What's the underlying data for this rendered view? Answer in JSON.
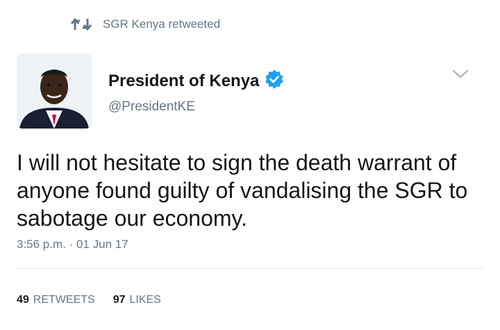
{
  "retweet_context": {
    "icon": "retweet-icon",
    "text": "SGR Kenya retweeted"
  },
  "author": {
    "display_name": "President of Kenya",
    "handle": "@PresidentKE",
    "verified": true,
    "verified_icon": "verified-badge-icon",
    "verified_color": "#1da1f2"
  },
  "tweet": {
    "text": "I will not hesitate to sign the death warrant of anyone found guilty of vandalising the SGR to sabotage our economy.",
    "timestamp": "3:56 p.m. · 01 Jun 17"
  },
  "stats": {
    "retweets_count": "49",
    "retweets_label": "RETWEETS",
    "likes_count": "97",
    "likes_label": "LIKES"
  },
  "menu_icon": "chevron-down-icon",
  "colors": {
    "text_primary": "#14171a",
    "text_secondary": "#657786",
    "divider": "#e1e8ed",
    "accent": "#1da1f2"
  }
}
